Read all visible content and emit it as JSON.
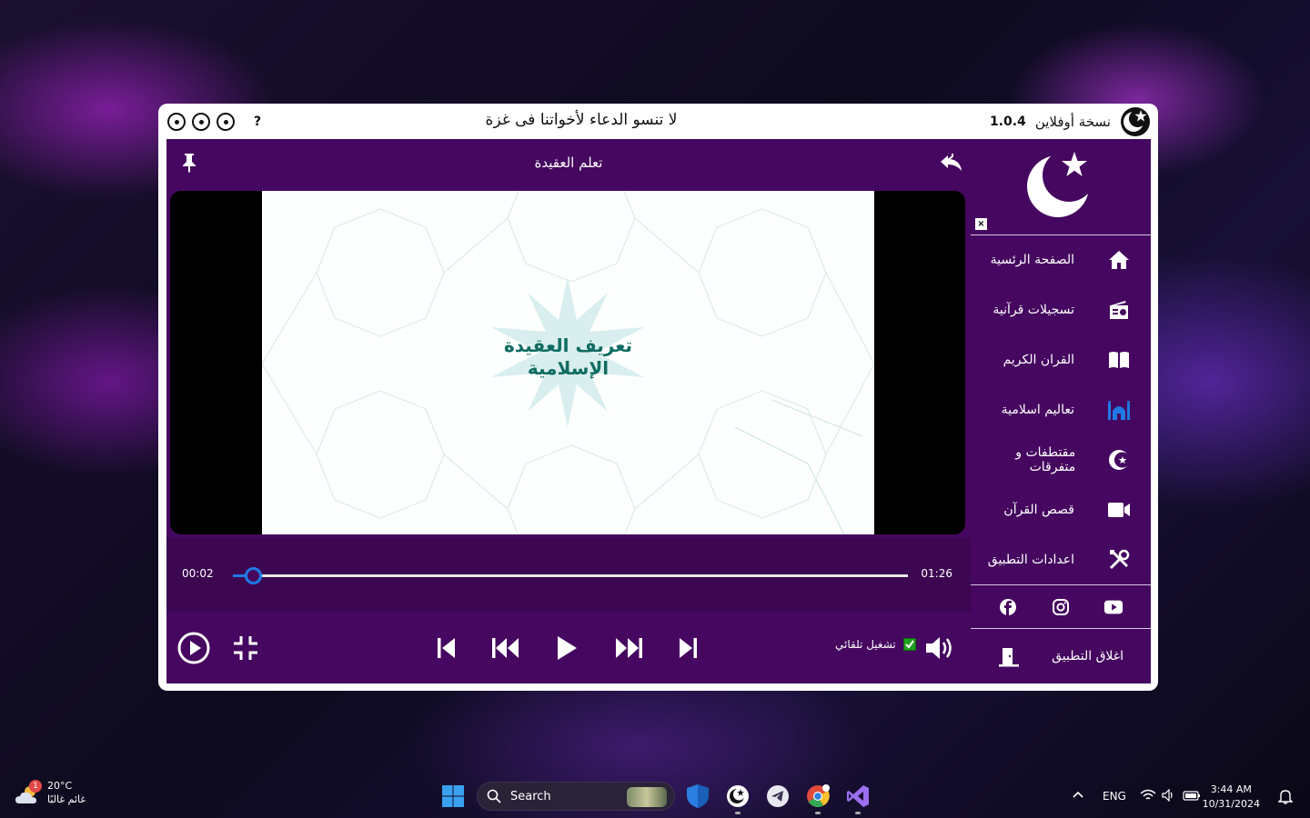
{
  "window": {
    "title_center": "لا تنسو الدعاء لأخواتنا فى غزة",
    "edition": "نسخة أوفلاين",
    "version": "1.0.4",
    "help": "?"
  },
  "player": {
    "title": "تعلم العقيدة",
    "slide_line1": "تعريف العقيدة",
    "slide_line2": "الإسلامية",
    "current_time": "00:02",
    "total_time": "01:26",
    "progress": 0.03,
    "autoplay_label": "تشغيل تلقائي",
    "autoplay_checked": true
  },
  "sidebar": {
    "close": "×",
    "items": [
      {
        "label": "الصفحة الرئسية",
        "icon": "home-icon"
      },
      {
        "label": "تسجيلات قرآنية",
        "icon": "radio-icon"
      },
      {
        "label": "القران الكريم",
        "icon": "book-icon"
      },
      {
        "label": "تعاليم اسلامية",
        "icon": "mosque-icon"
      },
      {
        "label": "مقتطفات و متفرقات",
        "icon": "crescent-star-icon"
      },
      {
        "label": "قصص القرآن",
        "icon": "video-camera-icon"
      },
      {
        "label": "اعدادات التطبيق",
        "icon": "tools-icon"
      }
    ],
    "socials": [
      "facebook-icon",
      "instagram-icon",
      "youtube-icon"
    ],
    "exit_label": "اغلاق التطبيق"
  },
  "taskbar": {
    "weather_temp": "20°C",
    "weather_cond": "غائم غالبًا",
    "weather_badge": "1",
    "search_label": "Search",
    "lang": "ENG",
    "time": "3:44 AM",
    "date": "10/31/2024"
  },
  "colors": {
    "panel": "#45075f",
    "accent": "#1e7be6",
    "slide_text": "#0f6c61"
  }
}
